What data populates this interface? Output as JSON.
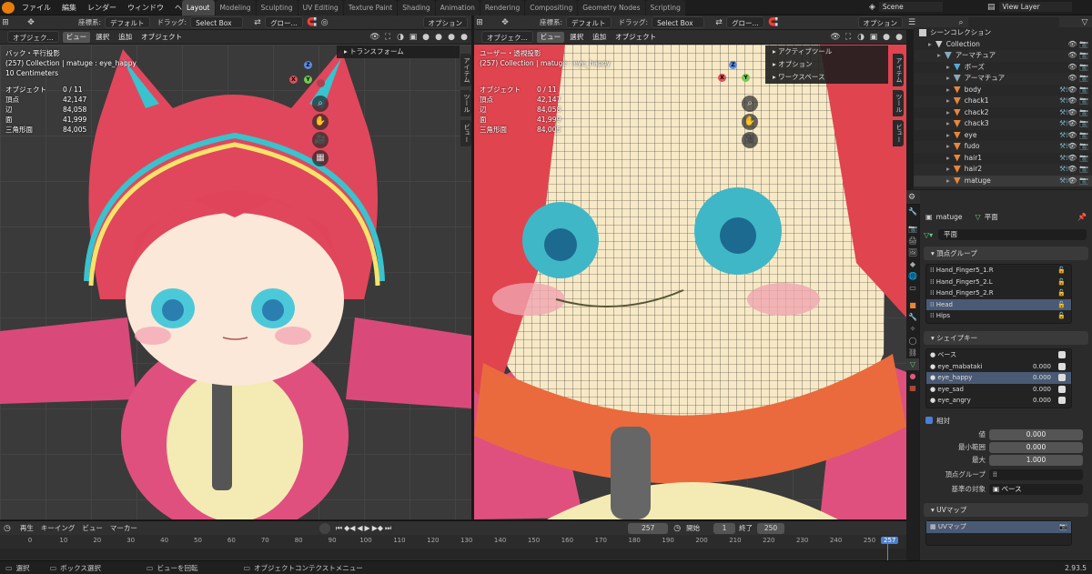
{
  "menu": {
    "items": [
      "ファイル",
      "編集",
      "レンダー",
      "ウィンドウ",
      "ヘルプ"
    ]
  },
  "workspaces": [
    {
      "label": "Layout",
      "active": true
    },
    {
      "label": "Modeling"
    },
    {
      "label": "Sculpting"
    },
    {
      "label": "UV Editing"
    },
    {
      "label": "Texture Paint"
    },
    {
      "label": "Shading"
    },
    {
      "label": "Animation"
    },
    {
      "label": "Rendering"
    },
    {
      "label": "Compositing"
    },
    {
      "label": "Geometry Nodes"
    },
    {
      "label": "Scripting"
    }
  ],
  "scene": {
    "name": "Scene",
    "view_layer": "View Layer"
  },
  "tool_header": {
    "orientation_label": "座標系:",
    "orientation_value": "デフォルト",
    "drag_label": "ドラッグ:",
    "drag_value": "Select Box",
    "pivot_value": "グロー...",
    "options": "オプション"
  },
  "vp_menu": {
    "mode": "オブジェク...",
    "view": "ビュー",
    "select": "選択",
    "add": "追加",
    "object": "オブジェクト"
  },
  "left_vp": {
    "view_name": "バック・平行投影",
    "collection_info": "(257) Collection | matuge : eye_happy",
    "scale": "10 Centimeters",
    "stats": [
      [
        "オブジェクト",
        "0 / 11"
      ],
      [
        "頂点",
        "42,147"
      ],
      [
        "辺",
        "84,058"
      ],
      [
        "面",
        "41,999"
      ],
      [
        "三角形面",
        "84,005"
      ]
    ],
    "popup": "トランスフォーム"
  },
  "right_vp": {
    "view_name": "ユーザー・透視投影",
    "collection_info": "(257) Collection | matuge : eye_happy",
    "stats": [
      [
        "オブジェクト",
        "0 / 11"
      ],
      [
        "頂点",
        "42,147"
      ],
      [
        "辺",
        "84,058"
      ],
      [
        "面",
        "41,999"
      ],
      [
        "三角形面",
        "84,005"
      ]
    ],
    "popup": [
      "アクティブツール",
      "オプション",
      "ワークスペース"
    ]
  },
  "side_tabs": [
    "アイテム",
    "ツール",
    "ビュー"
  ],
  "outliner": {
    "title": "シーンコレクション",
    "rows": [
      {
        "name": "Collection",
        "indent": 1
      },
      {
        "name": "アーマチュア",
        "indent": 2
      },
      {
        "name": "ボーズ",
        "indent": 3
      },
      {
        "name": "アーマチュア",
        "indent": 3
      },
      {
        "name": "body",
        "indent": 3
      },
      {
        "name": "chack1",
        "indent": 3
      },
      {
        "name": "chack2",
        "indent": 3
      },
      {
        "name": "chack3",
        "indent": 3
      },
      {
        "name": "eye",
        "indent": 3
      },
      {
        "name": "fudo",
        "indent": 3
      },
      {
        "name": "hair1",
        "indent": 3
      },
      {
        "name": "hair2",
        "indent": 3
      },
      {
        "name": "matuge",
        "indent": 3
      }
    ]
  },
  "props": {
    "object_name": "matuge",
    "mesh_name": "平面",
    "mesh_field": "平面",
    "vgroups_title": "頂点グループ",
    "vgroups": [
      "Hand_Finger5_1.R",
      "Hand_Finger5_2.L",
      "Hand_Finger5_2.R",
      "Head",
      "Hips"
    ],
    "vgroup_selected": "Head",
    "shapekeys_title": "シェイプキー",
    "shapekeys": [
      {
        "name": "ベース",
        "value": ""
      },
      {
        "name": "eye_mabataki",
        "value": "0.000"
      },
      {
        "name": "eye_happy",
        "value": "0.000"
      },
      {
        "name": "eye_sad",
        "value": "0.000"
      },
      {
        "name": "eye_angry",
        "value": "0.000"
      }
    ],
    "shapekey_selected": "eye_happy",
    "relative_label": "相対",
    "fields": [
      [
        "値",
        "0.000"
      ],
      [
        "最小範囲",
        "0.000"
      ],
      [
        "最大",
        "1.000"
      ]
    ],
    "vertex_group_label": "頂点グループ",
    "relative_to_label": "基準の対象",
    "relative_to_value": "ベース",
    "uv_title": "UVマップ",
    "uv_item": "UVマップ"
  },
  "timeline": {
    "playback": "再生",
    "keying": "キーイング",
    "view": "ビュー",
    "marker": "マーカー",
    "current": "257",
    "start_label": "開始",
    "start": "1",
    "end_label": "終了",
    "end": "250",
    "ticks": [
      "0",
      "10",
      "20",
      "30",
      "40",
      "50",
      "60",
      "70",
      "80",
      "90",
      "100",
      "110",
      "120",
      "130",
      "140",
      "150",
      "160",
      "170",
      "180",
      "190",
      "200",
      "210",
      "220",
      "230",
      "240",
      "250"
    ],
    "playhead": "257"
  },
  "status": {
    "select": "選択",
    "box": "ボックス選択",
    "rotate": "ビューを回転",
    "context": "オブジェクトコンテクストメニュー",
    "version": "2.93.5"
  }
}
